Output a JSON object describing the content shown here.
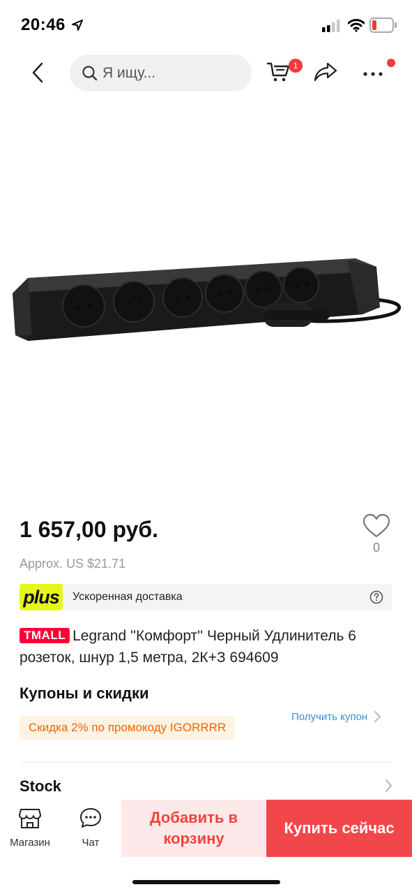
{
  "status_bar": {
    "time": "20:46"
  },
  "nav": {
    "search_placeholder": "Я ищу...",
    "cart_count": "1"
  },
  "product": {
    "price": "1 657,00 руб.",
    "approx_price": "Approx. US $21.71",
    "wishlist_count": "0",
    "delivery": {
      "logo": "plus",
      "text": "Ускоренная доставка"
    },
    "store_badge": "TMALL",
    "title": "Legrand ''Комфорт'' Черный Удлинитель 6 розеток, шнур 1,5 метра, 2К+З 694609"
  },
  "coupons": {
    "heading": "Купоны и скидки",
    "discount": "Скидка 2% по промокоду IGORRRR",
    "get_coupon": "Получить купон"
  },
  "stock": {
    "label": "Stock"
  },
  "bottom_bar": {
    "store_label": "Магазин",
    "chat_label": "Чат",
    "add_to_cart": "Добавить в корзину",
    "buy_now": "Купить сейчас"
  },
  "colors": {
    "accent": "#f2474a",
    "cart_badge": "#f23a3a",
    "tmall": "#ff0036",
    "plus": "#e5f61a",
    "coupon_text": "#f26500",
    "link": "#3a8fd0"
  },
  "icons": [
    "location-arrow-icon",
    "signal-icon",
    "wifi-icon",
    "battery-icon",
    "back-icon",
    "search-icon",
    "cart-icon",
    "share-icon",
    "more-icon",
    "heart-icon",
    "help-icon",
    "chevron-right-icon",
    "store-icon",
    "chat-icon"
  ]
}
